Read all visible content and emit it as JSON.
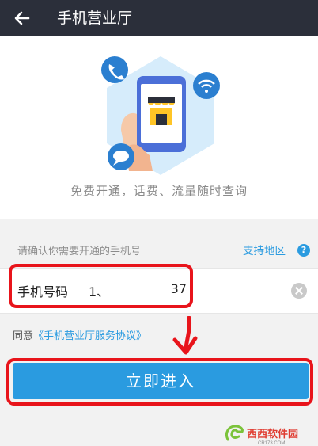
{
  "header": {
    "back_icon": "arrow-left-icon",
    "title": "手机营业厅"
  },
  "hero": {
    "illustration_icons": [
      "phone-call-icon",
      "wifi-icon",
      "chat-bubble-icon",
      "store-icon",
      "hand-holding-phone-icon"
    ],
    "tagline": "免费开通，话费、流量随时查询"
  },
  "form": {
    "confirm_label": "请确认你需要开通的手机号",
    "region_link": "支持地区",
    "help_icon": "question-icon",
    "help_glyph": "?",
    "phone_label": "手机号码",
    "phone_value_start": "1、",
    "phone_value_end": "37",
    "clear_icon": "clear-icon"
  },
  "agreement": {
    "prefix": "同意",
    "link": "《手机营业厅服务协议》"
  },
  "actions": {
    "enter_button": "立即进入"
  },
  "watermark": {
    "text": "西西软件园",
    "sub_text": "CR173.COM"
  },
  "colors": {
    "topbar": "#2b2f3a",
    "accent_blue": "#2a9be0",
    "annotation_red": "#e8141b",
    "background_gray": "#f2f2f2"
  }
}
